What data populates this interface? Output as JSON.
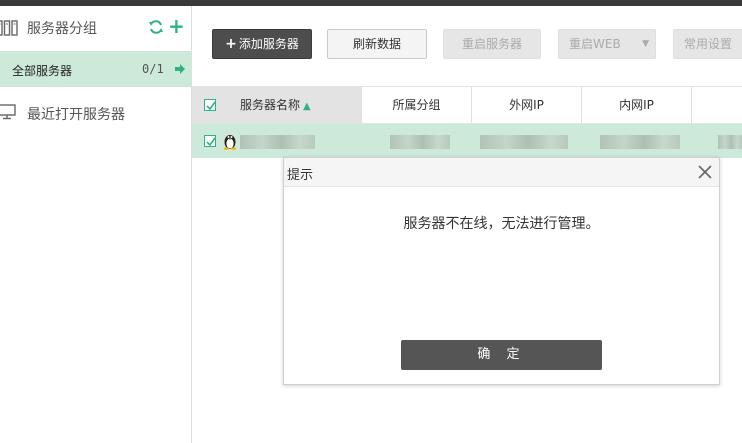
{
  "sidebar": {
    "title": "服务器分组",
    "all_servers": {
      "label": "全部服务器",
      "count": "0/1"
    },
    "recent": {
      "label": "最近打开服务器"
    }
  },
  "toolbar": {
    "add_server": "添加服务器",
    "refresh": "刷新数据",
    "restart_server": "重启服务器",
    "restart_web": "重启WEB",
    "common_settings": "常用设置"
  },
  "table": {
    "columns": [
      "服务器名称",
      "所属分组",
      "外网IP",
      "内网IP"
    ],
    "sort_indicator": "▲",
    "rows": [
      {
        "checked": true,
        "os_icon": "linux-penguin-icon"
      }
    ]
  },
  "dialog": {
    "title": "提示",
    "message": "服务器不在线，无法进行管理。",
    "ok": "确 定"
  },
  "colors": {
    "accent": "#2fb380",
    "selected_row": "#cde9d9",
    "dark_button": "#4d4d4d",
    "dialog_button": "#555555"
  }
}
